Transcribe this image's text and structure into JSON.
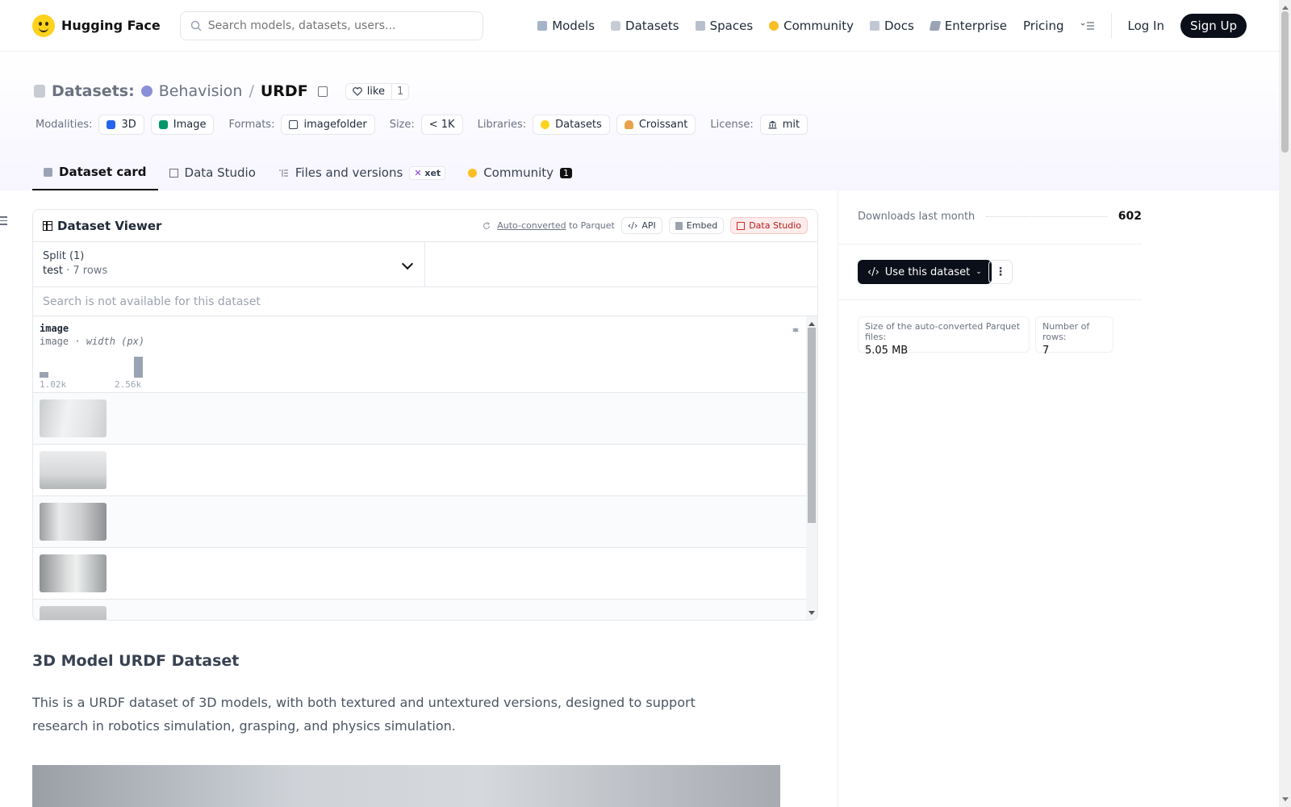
{
  "nav": {
    "brand": "Hugging Face",
    "search_placeholder": "Search models, datasets, users...",
    "links": [
      "Models",
      "Datasets",
      "Spaces",
      "Community",
      "Docs",
      "Enterprise",
      "Pricing"
    ],
    "login": "Log In",
    "signup": "Sign Up"
  },
  "header": {
    "section": "Datasets:",
    "org": "Behavision",
    "separator": "/",
    "repo": "URDF",
    "like_label": "like",
    "like_count": "1",
    "tags": {
      "modalities_label": "Modalities:",
      "modalities": [
        "3D",
        "Image"
      ],
      "formats_label": "Formats:",
      "format": "imagefolder",
      "size_label": "Size:",
      "size": "< 1K",
      "libraries_label": "Libraries:",
      "libraries": [
        "Datasets",
        "Croissant"
      ],
      "license_label": "License:",
      "license": "mit"
    },
    "tabs": [
      {
        "label": "Dataset card",
        "active": true
      },
      {
        "label": "Data Studio"
      },
      {
        "label": "Files and versions",
        "badge": "xet"
      },
      {
        "label": "Community",
        "badge": "1"
      }
    ]
  },
  "viewer": {
    "title": "Dataset Viewer",
    "auto_converted": "Auto-converted",
    "to_parquet": "to Parquet",
    "api": "API",
    "embed": "Embed",
    "data_studio": "Data Studio",
    "split_label": "Split (1)",
    "split_value": "test",
    "split_sep": "·",
    "split_rows": "7 rows",
    "search_na": "Search is not available for this dataset",
    "column": {
      "name": "image",
      "type": "image",
      "type_sep": "·",
      "stat": "width (px)",
      "hist_min": "1.02k",
      "hist_max": "2.56k",
      "hist_bins": [
        0.28,
        1.0
      ]
    }
  },
  "card": {
    "heading": "3D Model URDF Dataset",
    "paragraph": "This is a URDF dataset of 3D models, with both textured and untextured versions, designed to support research in robotics simulation, grasping, and physics simulation."
  },
  "sidebar": {
    "downloads_label": "Downloads last month",
    "downloads": "602",
    "use_dataset": "Use this dataset",
    "parquet_size_label": "Size of the auto-converted Parquet files:",
    "parquet_size": "5.05 MB",
    "rows_label": "Number of rows:",
    "rows": "7"
  },
  "colors": {
    "accent_dark": "#0b0f19",
    "hf_yellow": "#ffd21e",
    "data_studio_red": "#b91c1c"
  }
}
